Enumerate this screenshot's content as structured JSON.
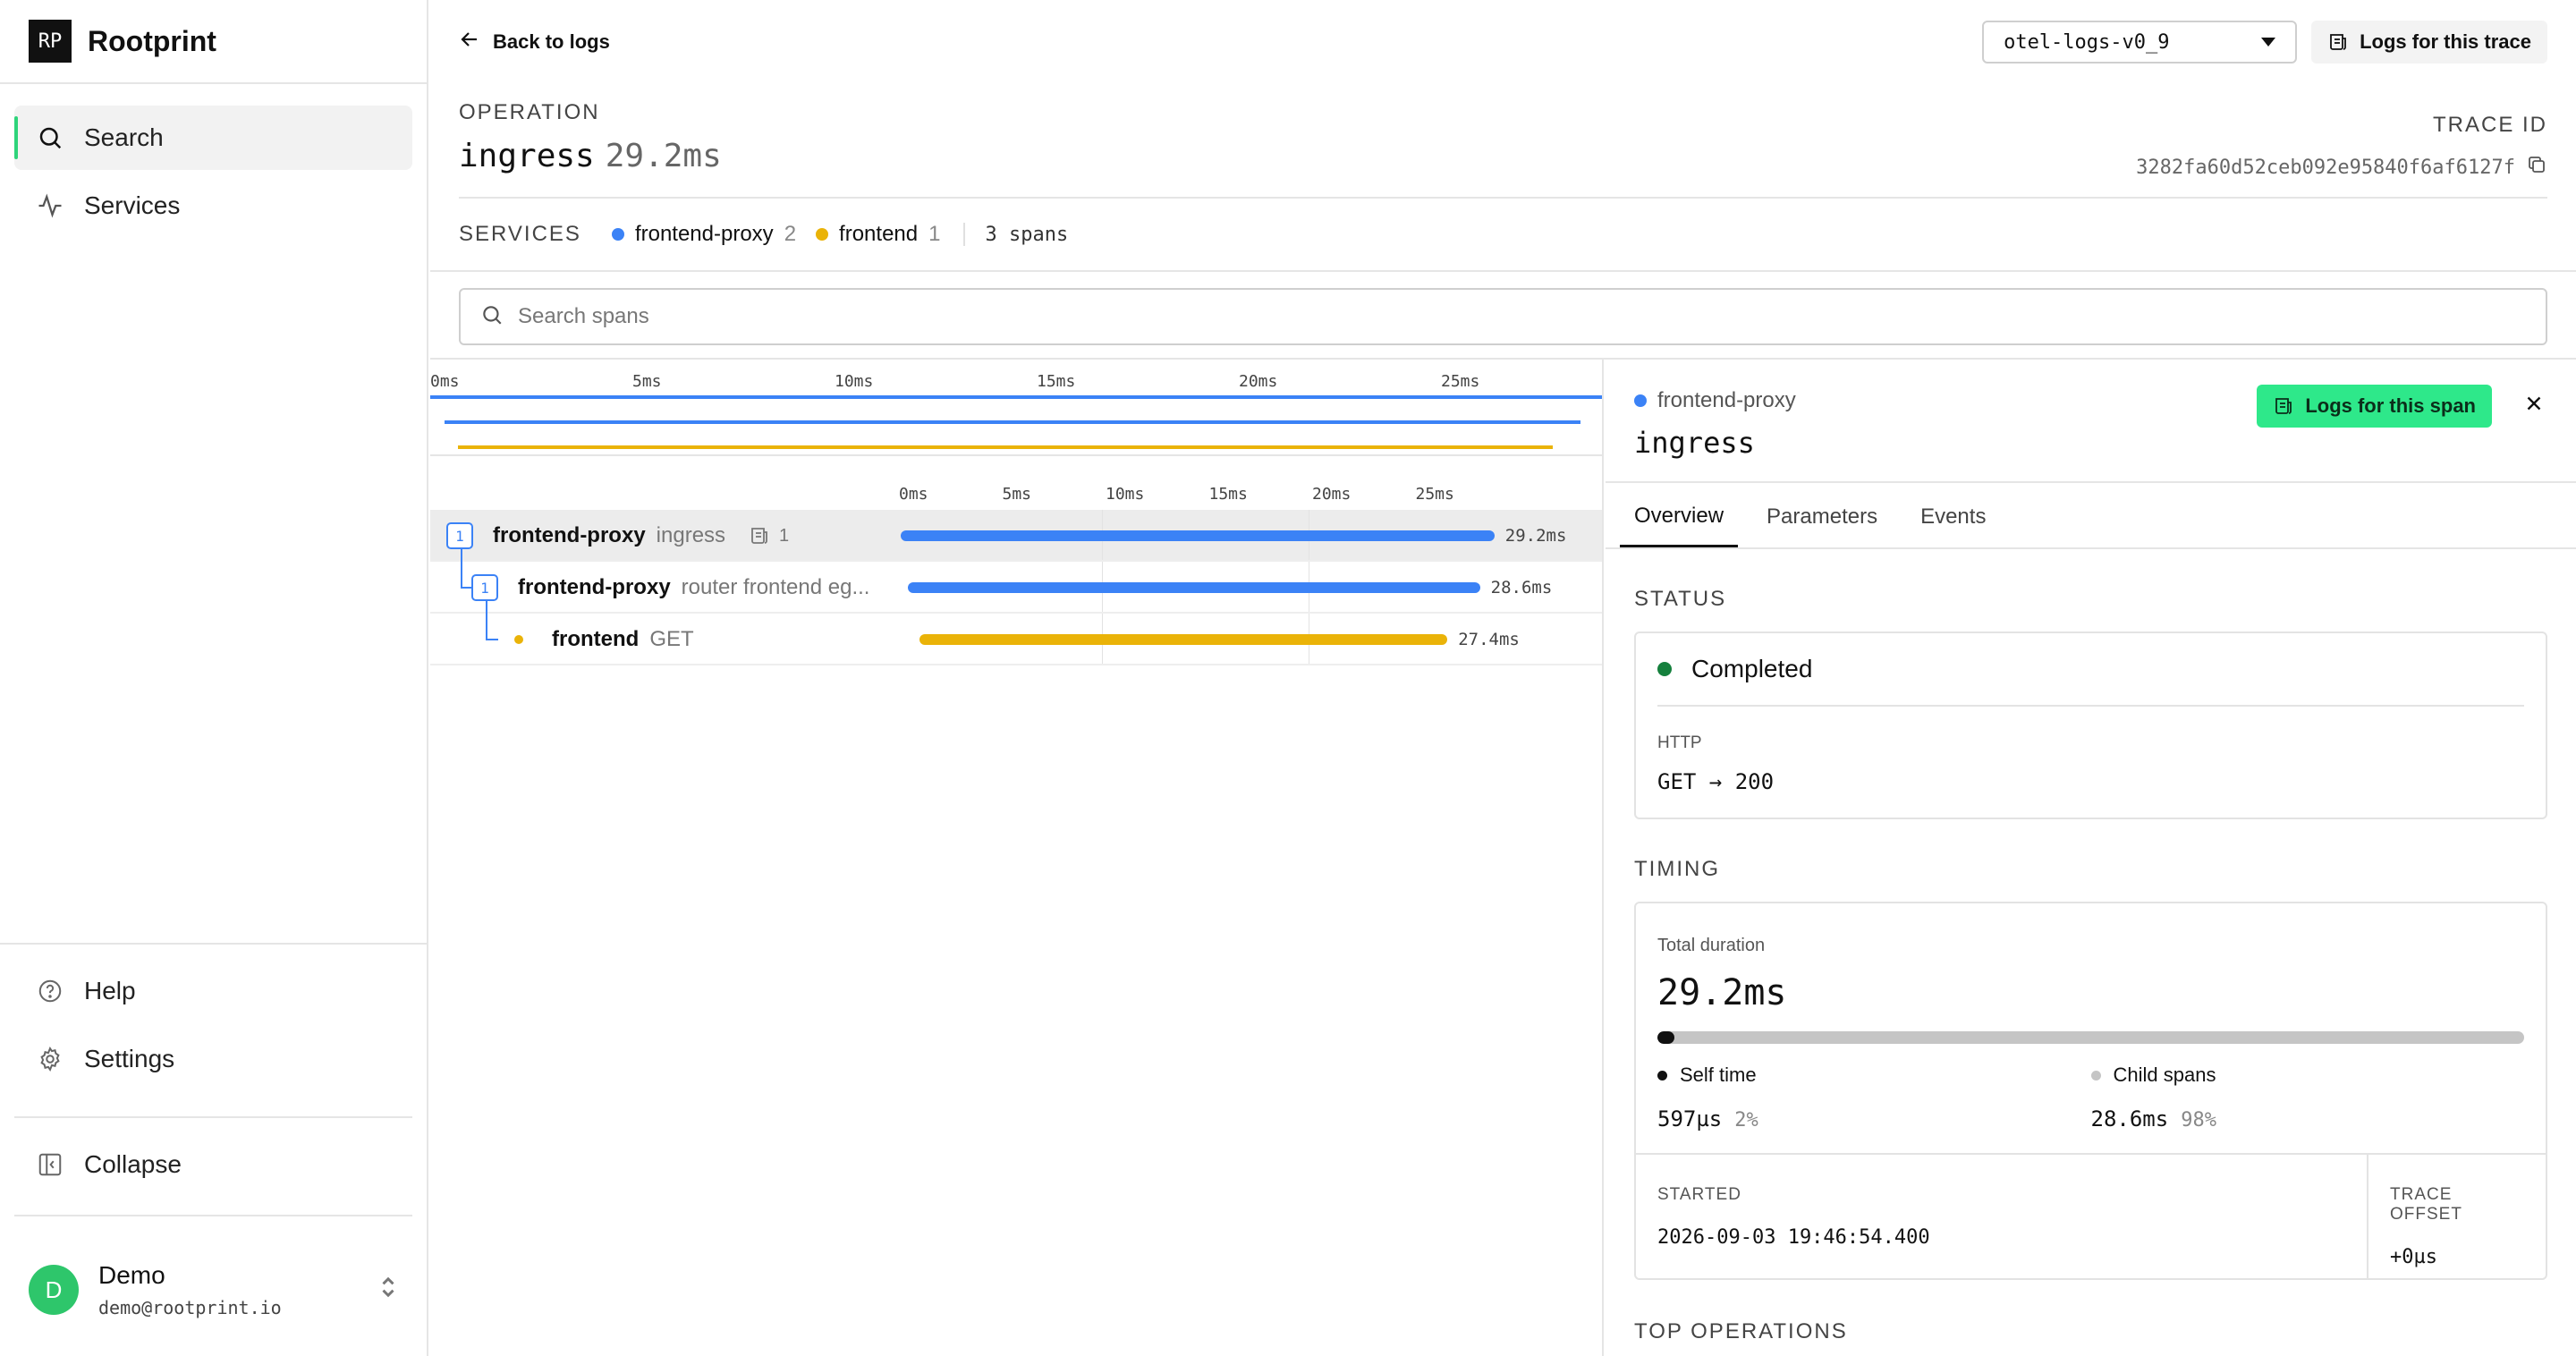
{
  "app": {
    "logo_text": "RP",
    "name": "Rootprint"
  },
  "sidebar": {
    "nav": [
      {
        "label": "Search",
        "icon": "search-icon",
        "active": true
      },
      {
        "label": "Services",
        "icon": "activity-icon",
        "active": false
      }
    ],
    "bottom": [
      {
        "label": "Help",
        "icon": "help-circle-icon"
      },
      {
        "label": "Settings",
        "icon": "gear-icon"
      }
    ],
    "collapse_label": "Collapse",
    "user": {
      "initial": "D",
      "name": "Demo",
      "email": "demo@rootprint.io"
    }
  },
  "topbar": {
    "back_label": "Back to logs",
    "dataset": "otel-logs-v0_9",
    "trace_logs_label": "Logs for this trace"
  },
  "operation": {
    "label": "OPERATION",
    "name": "ingress",
    "duration": "29.2ms",
    "trace_id_label": "TRACE ID",
    "trace_id": "3282fa60d52ceb092e95840f6af6127f"
  },
  "services_bar": {
    "label": "SERVICES",
    "services": [
      {
        "name": "frontend-proxy",
        "count": "2",
        "color": "#3b82f6"
      },
      {
        "name": "frontend",
        "count": "1",
        "color": "#eab308"
      }
    ],
    "span_count": "3 spans"
  },
  "search": {
    "placeholder": "Search spans",
    "value": ""
  },
  "timeline": {
    "total_ms": 29.2,
    "minimap_ticks": [
      "0ms",
      "5ms",
      "10ms",
      "15ms",
      "20ms",
      "25ms"
    ],
    "ruler_ticks": [
      "0ms",
      "5ms",
      "10ms",
      "15ms",
      "20ms",
      "25ms"
    ],
    "spans": [
      {
        "service": "frontend-proxy",
        "operation": "ingress",
        "child_count": "1",
        "logs_count": "1",
        "start_ms": 0,
        "duration_ms": 29.2,
        "duration_label": "29.2ms",
        "color": "#3b82f6",
        "depth": 0,
        "selected": true
      },
      {
        "service": "frontend-proxy",
        "operation": "router frontend eg...",
        "child_count": "1",
        "logs_count": "",
        "start_ms": 0.2,
        "duration_ms": 28.6,
        "duration_label": "28.6ms",
        "color": "#3b82f6",
        "depth": 1,
        "selected": false
      },
      {
        "service": "frontend",
        "operation": "GET",
        "child_count": "",
        "logs_count": "",
        "start_ms": 0.7,
        "duration_ms": 27.4,
        "duration_label": "27.4ms",
        "color": "#eab308",
        "depth": 2,
        "selected": false
      }
    ]
  },
  "detail": {
    "service": "frontend-proxy",
    "service_color": "#3b82f6",
    "operation": "ingress",
    "logs_button": "Logs for this span",
    "tabs": [
      "Overview",
      "Parameters",
      "Events"
    ],
    "active_tab": "Overview",
    "status_section": "STATUS",
    "status": "Completed",
    "status_color": "#15803d",
    "http_label": "HTTP",
    "http_method": "GET",
    "http_status": "200",
    "timing_section": "TIMING",
    "total_duration_label": "Total duration",
    "total_duration": "29.2ms",
    "self_fraction": 0.02,
    "self_time_label": "Self time",
    "self_time": "597µs",
    "self_pct": "2%",
    "child_spans_label": "Child spans",
    "child_time": "28.6ms",
    "child_pct": "98%",
    "started_label": "STARTED",
    "started": "2026-09-03 19:46:54.400",
    "offset_label": "TRACE OFFSET",
    "offset": "+0µs",
    "top_ops_section": "TOP OPERATIONS"
  }
}
